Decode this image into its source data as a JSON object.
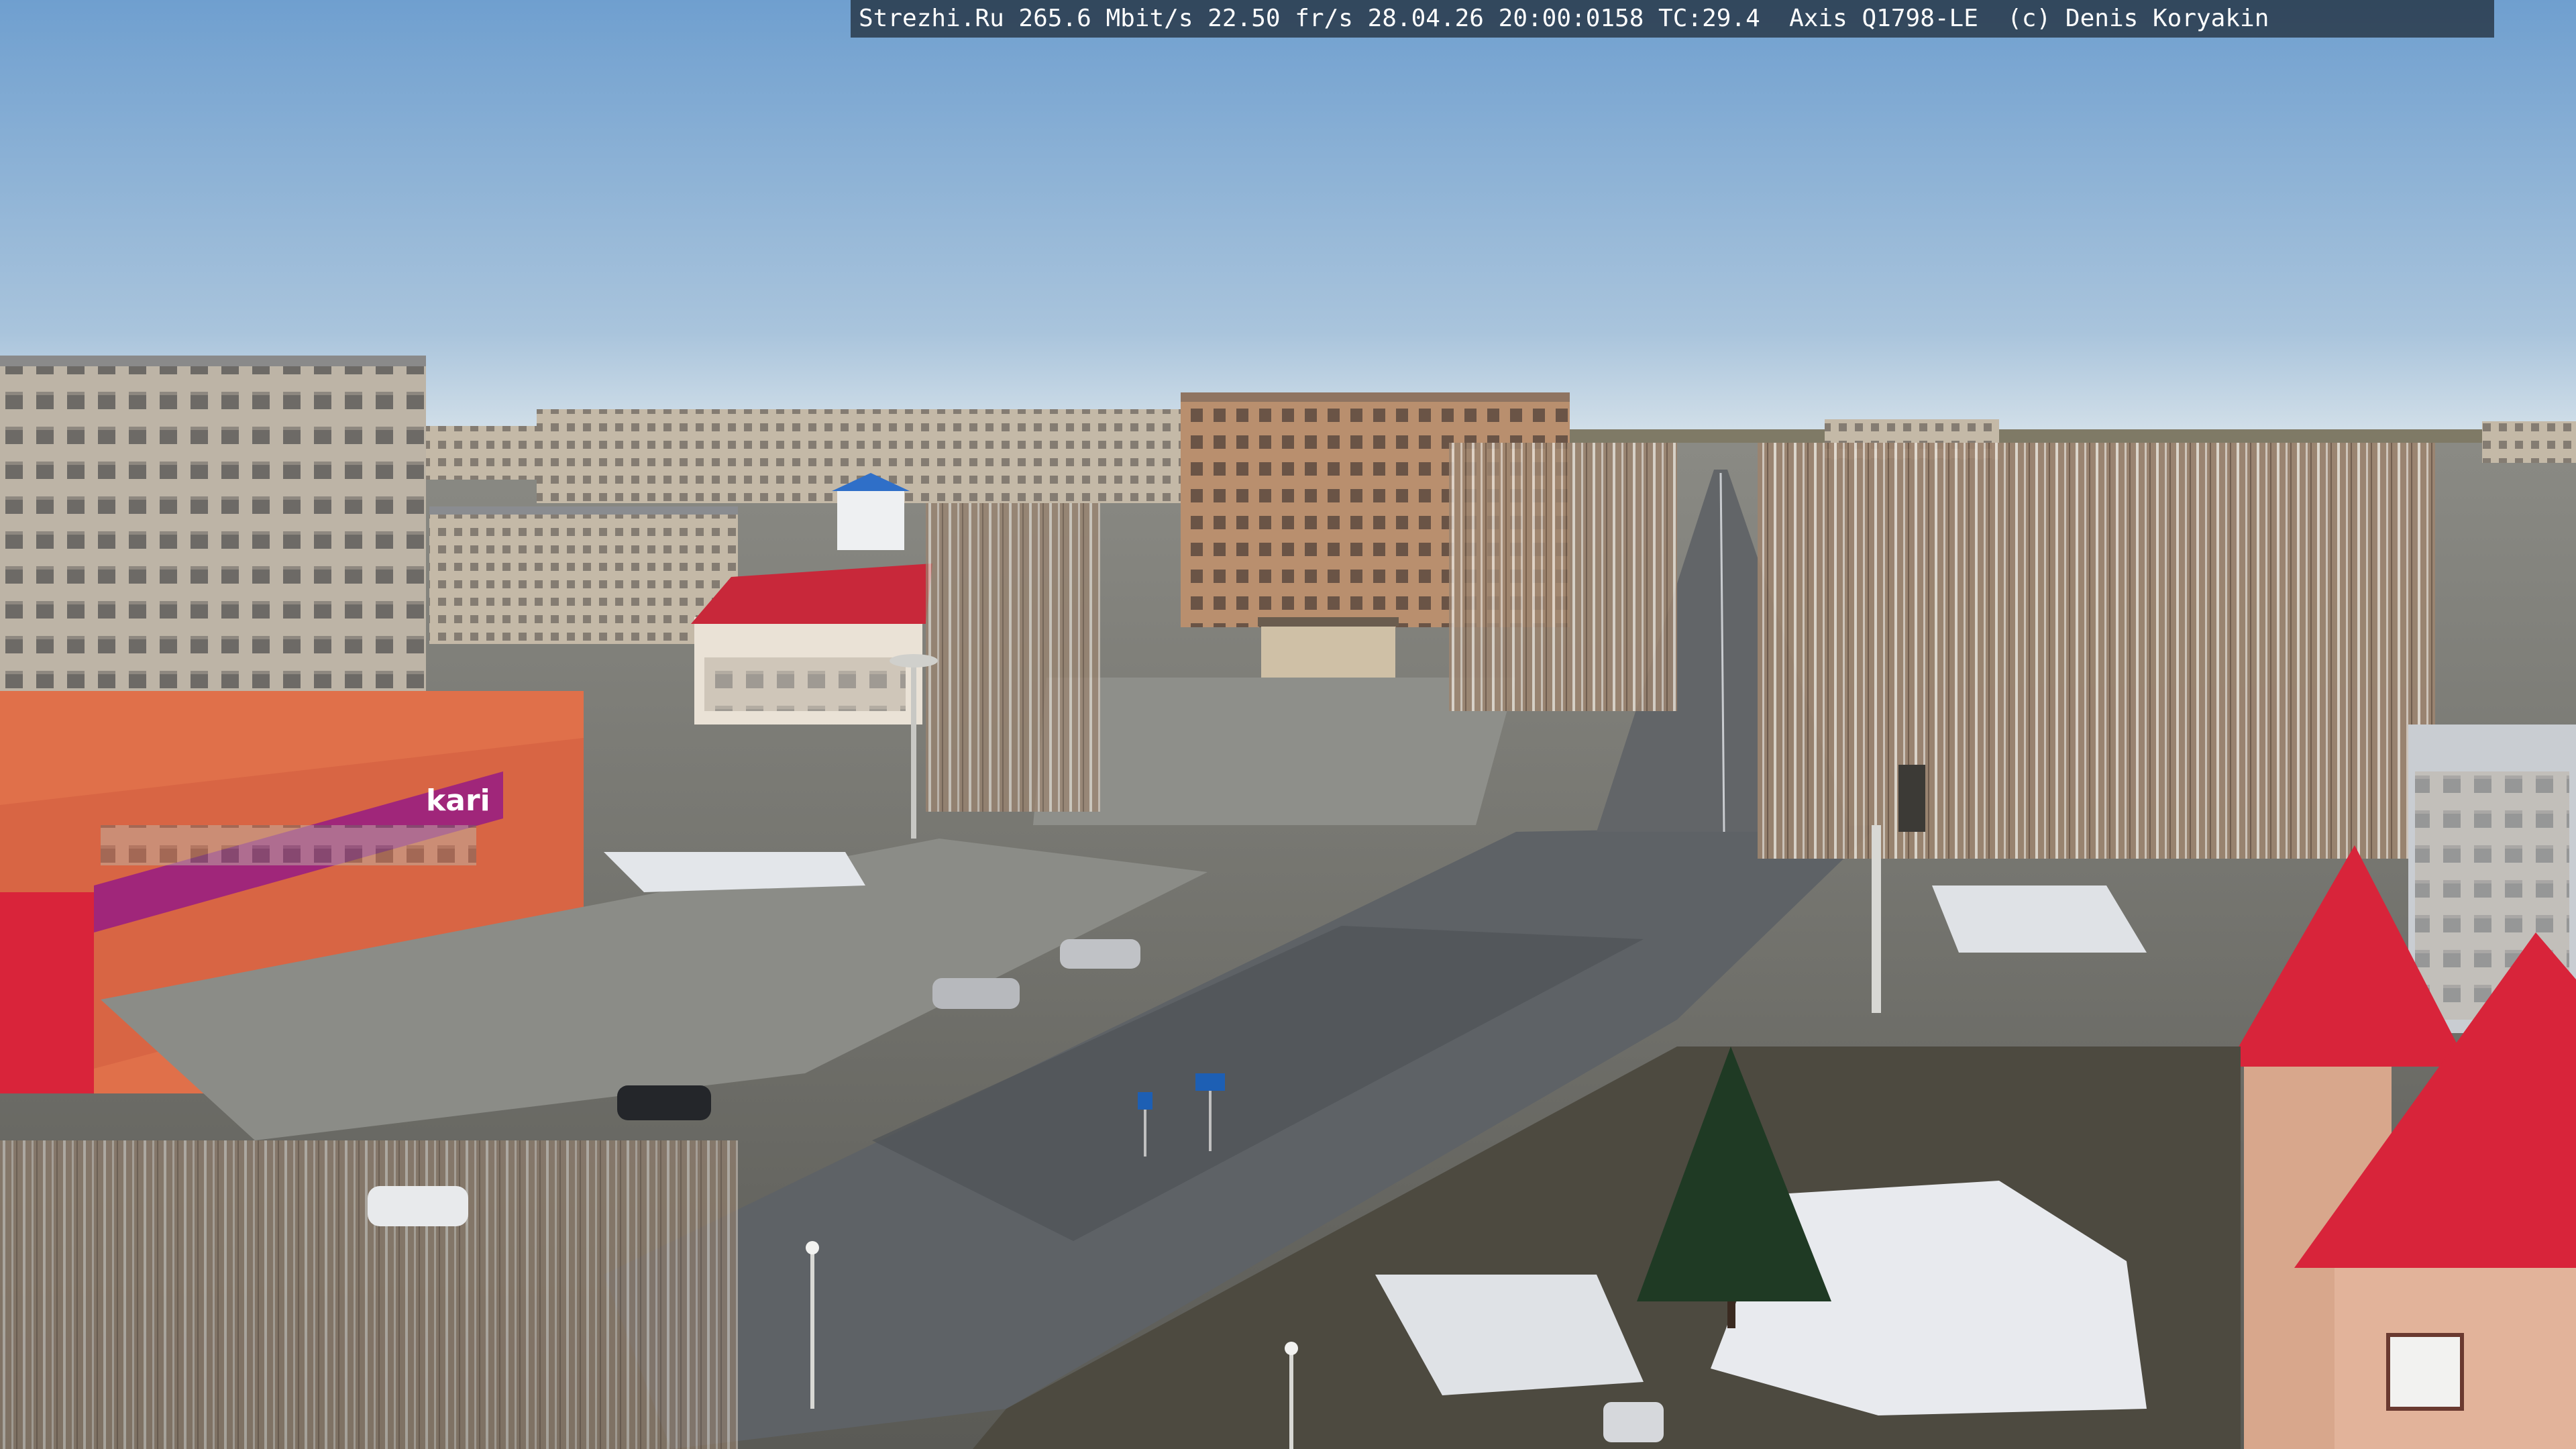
{
  "overlay": {
    "text": "Strezhi.Ru 265.6 Mbit/s 22.50 fr/s 28.04.26 20:00:0158 TC:29.4  Axis Q1798-LE  (c) Denis Koryakin"
  },
  "signs": {
    "store_logo": "kari"
  },
  "colors": {
    "sky_top": "#6f9fcf",
    "sky_horizon": "#d6e2ea",
    "roof_red": "#d8223a",
    "store_facade": "#e0704a",
    "kari_banner": "#a0267a",
    "ground": "#7d7e78",
    "road": "#5e6266",
    "snow": "#e8eaee",
    "birch_grove": "#a58b75"
  },
  "icons": [
    "street-lamp-icon",
    "road-sign-icon"
  ]
}
